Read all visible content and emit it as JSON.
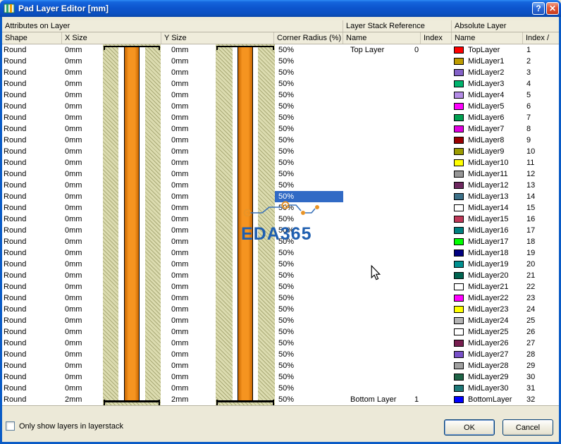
{
  "window": {
    "title": "Pad Layer Editor [mm]",
    "help_label": "?",
    "close_label": "✕"
  },
  "group_headers": [
    "Attributes on Layer",
    "Layer Stack Reference",
    "Absolute Layer"
  ],
  "column_headers": [
    "Shape",
    "X Size",
    "Y Size",
    "Corner Radius (%)",
    "Name",
    "Index",
    "Name",
    "Index /"
  ],
  "selection": {
    "row_index": 13
  },
  "watermark": {
    "text": "EDA365"
  },
  "footer": {
    "checkbox_label": "Only show layers in layerstack",
    "checkbox_checked": false,
    "ok_label": "OK",
    "cancel_label": "Cancel"
  },
  "colors": {
    "selection_bg": "#316AC5",
    "board": "#DCDCB0",
    "barrel": "#F59420",
    "hole": "#FFFFFF"
  },
  "rows": [
    {
      "shape": "Round",
      "x_size": "0mm",
      "y_size": "0mm",
      "corner_radius": "50%",
      "stack_name": "Top Layer",
      "stack_index": "0",
      "color": "#FF0000",
      "abs_name": "TopLayer",
      "abs_index": "1"
    },
    {
      "shape": "Round",
      "x_size": "0mm",
      "y_size": "0mm",
      "corner_radius": "50%",
      "stack_name": "",
      "stack_index": "",
      "color": "#BE9C00",
      "abs_name": "MidLayer1",
      "abs_index": "2"
    },
    {
      "shape": "Round",
      "x_size": "0mm",
      "y_size": "0mm",
      "corner_radius": "50%",
      "stack_name": "",
      "stack_index": "",
      "color": "#8462C8",
      "abs_name": "MidLayer2",
      "abs_index": "3"
    },
    {
      "shape": "Round",
      "x_size": "0mm",
      "y_size": "0mm",
      "corner_radius": "50%",
      "stack_name": "",
      "stack_index": "",
      "color": "#00B46E",
      "abs_name": "MidLayer3",
      "abs_index": "4"
    },
    {
      "shape": "Round",
      "x_size": "0mm",
      "y_size": "0mm",
      "corner_radius": "50%",
      "stack_name": "",
      "stack_index": "",
      "color": "#B48CE6",
      "abs_name": "MidLayer4",
      "abs_index": "5"
    },
    {
      "shape": "Round",
      "x_size": "0mm",
      "y_size": "0mm",
      "corner_radius": "50%",
      "stack_name": "",
      "stack_index": "",
      "color": "#FF00FF",
      "abs_name": "MidLayer5",
      "abs_index": "6"
    },
    {
      "shape": "Round",
      "x_size": "0mm",
      "y_size": "0mm",
      "corner_radius": "50%",
      "stack_name": "",
      "stack_index": "",
      "color": "#00A050",
      "abs_name": "MidLayer6",
      "abs_index": "7"
    },
    {
      "shape": "Round",
      "x_size": "0mm",
      "y_size": "0mm",
      "corner_radius": "50%",
      "stack_name": "",
      "stack_index": "",
      "color": "#E000E0",
      "abs_name": "MidLayer7",
      "abs_index": "8"
    },
    {
      "shape": "Round",
      "x_size": "0mm",
      "y_size": "0mm",
      "corner_radius": "50%",
      "stack_name": "",
      "stack_index": "",
      "color": "#990000",
      "abs_name": "MidLayer8",
      "abs_index": "9"
    },
    {
      "shape": "Round",
      "x_size": "0mm",
      "y_size": "0mm",
      "corner_radius": "50%",
      "stack_name": "",
      "stack_index": "",
      "color": "#9C9C00",
      "abs_name": "MidLayer9",
      "abs_index": "10"
    },
    {
      "shape": "Round",
      "x_size": "0mm",
      "y_size": "0mm",
      "corner_radius": "50%",
      "stack_name": "",
      "stack_index": "",
      "color": "#FFFF00",
      "abs_name": "MidLayer10",
      "abs_index": "11"
    },
    {
      "shape": "Round",
      "x_size": "0mm",
      "y_size": "0mm",
      "corner_radius": "50%",
      "stack_name": "",
      "stack_index": "",
      "color": "#969696",
      "abs_name": "MidLayer11",
      "abs_index": "12"
    },
    {
      "shape": "Round",
      "x_size": "0mm",
      "y_size": "0mm",
      "corner_radius": "50%",
      "stack_name": "",
      "stack_index": "",
      "color": "#6E2860",
      "abs_name": "MidLayer12",
      "abs_index": "13"
    },
    {
      "shape": "Round",
      "x_size": "0mm",
      "y_size": "0mm",
      "corner_radius": "50%",
      "stack_name": "",
      "stack_index": "",
      "color": "#3C7088",
      "abs_name": "MidLayer13",
      "abs_index": "14"
    },
    {
      "shape": "Round",
      "x_size": "0mm",
      "y_size": "0mm",
      "corner_radius": "50%",
      "stack_name": "",
      "stack_index": "",
      "color": "#FFFFFF",
      "abs_name": "MidLayer14",
      "abs_index": "15"
    },
    {
      "shape": "Round",
      "x_size": "0mm",
      "y_size": "0mm",
      "corner_radius": "50%",
      "stack_name": "",
      "stack_index": "",
      "color": "#C03858",
      "abs_name": "MidLayer15",
      "abs_index": "16"
    },
    {
      "shape": "Round",
      "x_size": "0mm",
      "y_size": "0mm",
      "corner_radius": "50%",
      "stack_name": "",
      "stack_index": "",
      "color": "#008080",
      "abs_name": "MidLayer16",
      "abs_index": "17"
    },
    {
      "shape": "Round",
      "x_size": "0mm",
      "y_size": "0mm",
      "corner_radius": "50%",
      "stack_name": "",
      "stack_index": "",
      "color": "#00FF00",
      "abs_name": "MidLayer17",
      "abs_index": "18"
    },
    {
      "shape": "Round",
      "x_size": "0mm",
      "y_size": "0mm",
      "corner_radius": "50%",
      "stack_name": "",
      "stack_index": "",
      "color": "#000080",
      "abs_name": "MidLayer18",
      "abs_index": "19"
    },
    {
      "shape": "Round",
      "x_size": "0mm",
      "y_size": "0mm",
      "corner_radius": "50%",
      "stack_name": "",
      "stack_index": "",
      "color": "#009090",
      "abs_name": "MidLayer19",
      "abs_index": "20"
    },
    {
      "shape": "Round",
      "x_size": "0mm",
      "y_size": "0mm",
      "corner_radius": "50%",
      "stack_name": "",
      "stack_index": "",
      "color": "#006450",
      "abs_name": "MidLayer20",
      "abs_index": "21"
    },
    {
      "shape": "Round",
      "x_size": "0mm",
      "y_size": "0mm",
      "corner_radius": "50%",
      "stack_name": "",
      "stack_index": "",
      "color": "#FFFFFF",
      "abs_name": "MidLayer21",
      "abs_index": "22"
    },
    {
      "shape": "Round",
      "x_size": "0mm",
      "y_size": "0mm",
      "corner_radius": "50%",
      "stack_name": "",
      "stack_index": "",
      "color": "#FF00FF",
      "abs_name": "MidLayer22",
      "abs_index": "23"
    },
    {
      "shape": "Round",
      "x_size": "0mm",
      "y_size": "0mm",
      "corner_radius": "50%",
      "stack_name": "",
      "stack_index": "",
      "color": "#FFFF00",
      "abs_name": "MidLayer23",
      "abs_index": "24"
    },
    {
      "shape": "Round",
      "x_size": "0mm",
      "y_size": "0mm",
      "corner_radius": "50%",
      "stack_name": "",
      "stack_index": "",
      "color": "#B4B4B4",
      "abs_name": "MidLayer24",
      "abs_index": "25"
    },
    {
      "shape": "Round",
      "x_size": "0mm",
      "y_size": "0mm",
      "corner_radius": "50%",
      "stack_name": "",
      "stack_index": "",
      "color": "#FFFFFF",
      "abs_name": "MidLayer25",
      "abs_index": "26"
    },
    {
      "shape": "Round",
      "x_size": "0mm",
      "y_size": "0mm",
      "corner_radius": "50%",
      "stack_name": "",
      "stack_index": "",
      "color": "#781E50",
      "abs_name": "MidLayer26",
      "abs_index": "27"
    },
    {
      "shape": "Round",
      "x_size": "0mm",
      "y_size": "0mm",
      "corner_radius": "50%",
      "stack_name": "",
      "stack_index": "",
      "color": "#7850C8",
      "abs_name": "MidLayer27",
      "abs_index": "28"
    },
    {
      "shape": "Round",
      "x_size": "0mm",
      "y_size": "0mm",
      "corner_radius": "50%",
      "stack_name": "",
      "stack_index": "",
      "color": "#A0A0A0",
      "abs_name": "MidLayer28",
      "abs_index": "29"
    },
    {
      "shape": "Round",
      "x_size": "0mm",
      "y_size": "0mm",
      "corner_radius": "50%",
      "stack_name": "",
      "stack_index": "",
      "color": "#1E6446",
      "abs_name": "MidLayer29",
      "abs_index": "30"
    },
    {
      "shape": "Round",
      "x_size": "0mm",
      "y_size": "0mm",
      "corner_radius": "50%",
      "stack_name": "",
      "stack_index": "",
      "color": "#1E7878",
      "abs_name": "MidLayer30",
      "abs_index": "31"
    },
    {
      "shape": "Round",
      "x_size": "2mm",
      "y_size": "2mm",
      "corner_radius": "50%",
      "stack_name": "Bottom Layer",
      "stack_index": "1",
      "color": "#0000FF",
      "abs_name": "BottomLayer",
      "abs_index": "32"
    }
  ]
}
